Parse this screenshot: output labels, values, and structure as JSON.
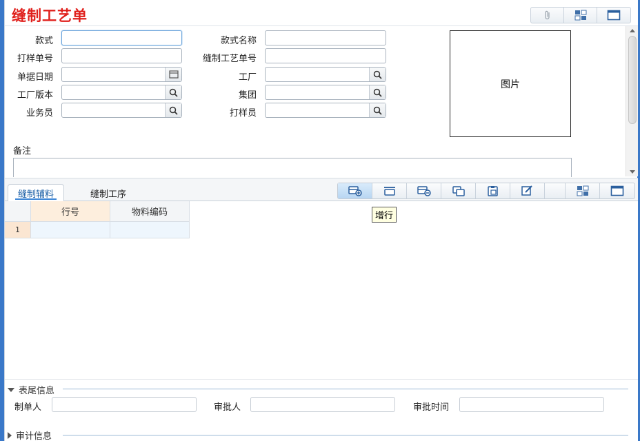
{
  "window": {
    "title": "缝制工艺单"
  },
  "form": {
    "style_label": "款式",
    "style_name_label": "款式名称",
    "sample_no_label": "打样单号",
    "process_no_label": "缝制工艺单号",
    "date_label": "单据日期",
    "factory_label": "工厂",
    "factory_version_label": "工厂版本",
    "group_label": "集团",
    "salesman_label": "业务员",
    "sampler_label": "打样员",
    "picture_label": "图片",
    "remark_label": "备注"
  },
  "tabs": [
    {
      "label": "缝制辅料",
      "active": true
    },
    {
      "label": "缝制工序",
      "active": false
    }
  ],
  "grid": {
    "columns": [
      "行号",
      "物料编码"
    ],
    "rows": [
      {
        "num": "1",
        "line_no": "",
        "material_code": ""
      }
    ],
    "tooltip": "增行"
  },
  "footer": {
    "tail_section": "表尾信息",
    "creator_label": "制单人",
    "approver_label": "审批人",
    "approve_time_label": "审批时间",
    "audit_section": "审计信息"
  },
  "colors": {
    "title": "#e0201c",
    "accent": "#3d86d6",
    "frame": "#3a78c8"
  }
}
